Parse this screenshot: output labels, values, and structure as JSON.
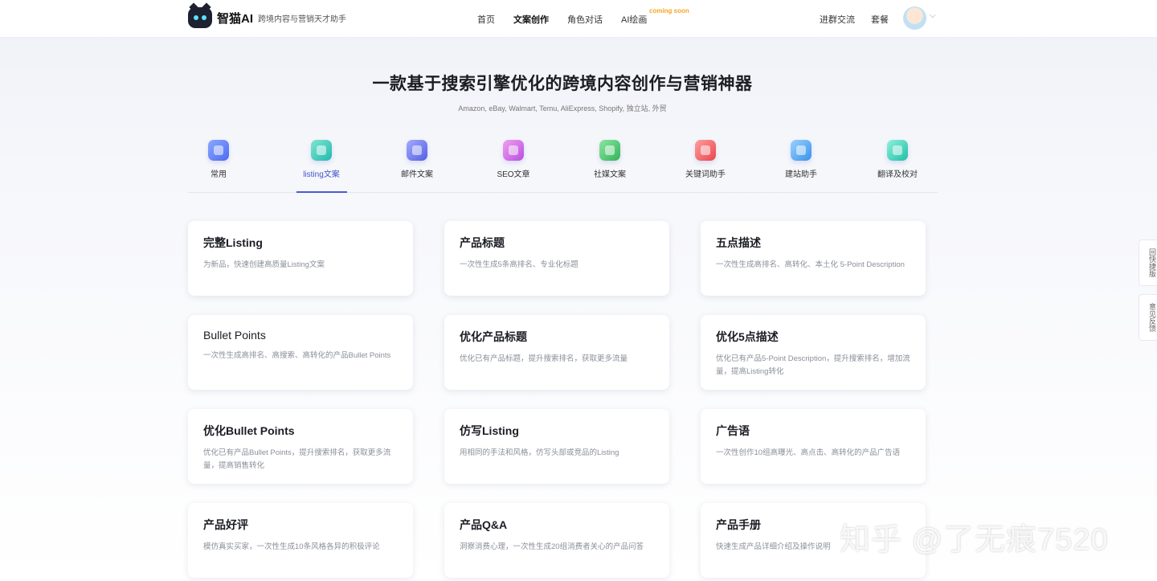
{
  "header": {
    "logo_name": "智猫AI",
    "slogan": "跨境内容与营销天才助手",
    "nav": [
      "首页",
      "文案创作",
      "角色对话",
      "AI绘画"
    ],
    "badge": "coming soon",
    "right_links": [
      "进群交流",
      "套餐"
    ]
  },
  "hero": {
    "title": "一款基于搜索引擎优化的跨境内容创作与营销神器",
    "subtitle": "Amazon, eBay, Walmart, Temu, AliExpress, Shopify, 独立站, 外贸"
  },
  "categories": [
    {
      "label": "常用",
      "color": "#5b7cf5"
    },
    {
      "label": "listing文案",
      "color": "#34c7b9"
    },
    {
      "label": "邮件文案",
      "color": "#6a74e6"
    },
    {
      "label": "SEO文章",
      "color": "#d066e0"
    },
    {
      "label": "社媒文案",
      "color": "#3fbf6a"
    },
    {
      "label": "关键词助手",
      "color": "#f0585c"
    },
    {
      "label": "建站助手",
      "color": "#4aa6f0"
    },
    {
      "label": "翻译及校对",
      "color": "#2fcfb8"
    }
  ],
  "cards": [
    {
      "title": "完整Listing",
      "desc": "为新品，快速创建高质量Listing文案"
    },
    {
      "title": "产品标题",
      "desc": "一次性生成5条高排名、专业化标题"
    },
    {
      "title": "五点描述",
      "desc": "一次性生成高排名、高转化、本土化 5-Point Description"
    },
    {
      "title": "Bullet Points",
      "desc": "一次性生成高排名、高搜索、高转化的产品Bullet Points"
    },
    {
      "title": "优化产品标题",
      "desc": "优化已有产品标题，提升搜索排名，获取更多流量"
    },
    {
      "title": "优化5点描述",
      "desc": "优化已有产品5-Point Description，提升搜索排名，增加流量，提高Listing转化"
    },
    {
      "title": "优化Bullet Points",
      "desc": "优化已有产品Bullet Points，提升搜索排名，获取更多流量，提高销售转化"
    },
    {
      "title": "仿写Listing",
      "desc": "用相同的手法和风格，仿写头部或竞品的Listing"
    },
    {
      "title": "广告语",
      "desc": "一次性创作10组高曝光、高点击、高转化的产品广告语"
    },
    {
      "title": "产品好评",
      "desc": "模仿真实买家，一次性生成10条风格各异的积极评论"
    },
    {
      "title": "产品Q&A",
      "desc": "洞察消费心理，一次性生成20组消费者关心的产品问答"
    },
    {
      "title": "产品手册",
      "desc": "快速生成产品详细介绍及操作说明"
    }
  ],
  "side": {
    "back_old": "回快捷版",
    "feedback": "意见反馈"
  },
  "watermark": "知乎 @了无痕7520"
}
